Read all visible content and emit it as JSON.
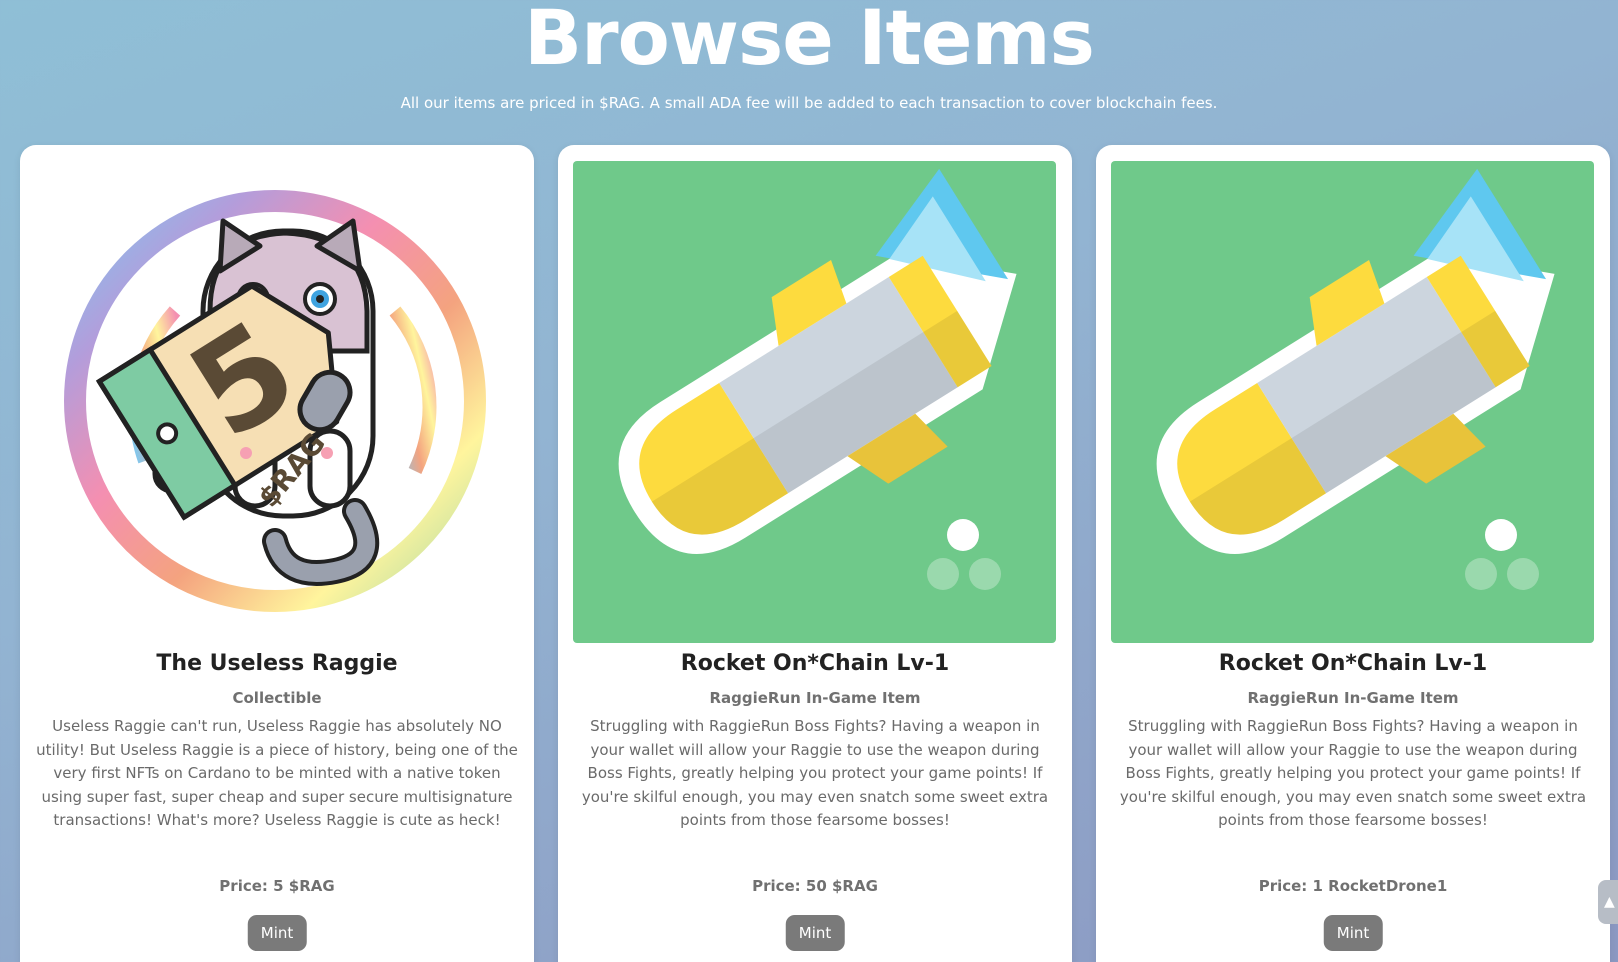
{
  "header": {
    "title": "Browse Items",
    "subtitle": "All our items are priced in $RAG. A small ADA fee will be added to each transaction to cover blockchain fees."
  },
  "items": [
    {
      "title": "The Useless Raggie",
      "category": "Collectible",
      "description": "Useless Raggie can't run, Useless Raggie has absolutely NO utility! But Useless Raggie is a piece of history, being one of the very first NFTs on Cardano to be minted with a native token using super fast, super cheap and super secure multisignature transactions! What's more? Useless Raggie is cute as heck!",
      "price": "Price: 5 $RAG",
      "button": "Mint",
      "image_icon": "raggie-cat-price-tag",
      "tag_number": "5",
      "tag_text": "$RAG"
    },
    {
      "title": "Rocket On*Chain Lv-1",
      "category": "RaggieRun In-Game Item",
      "description": "Struggling with RaggieRun Boss Fights? Having a weapon in your wallet will allow your Raggie to use the weapon during Boss Fights, greatly helping you protect your game points! If you're skilful enough, you may even snatch some sweet extra points from those fearsome bosses!",
      "price": "Price: 50 $RAG",
      "button": "Mint",
      "image_icon": "rocket"
    },
    {
      "title": "Rocket On*Chain Lv-1",
      "category": "RaggieRun In-Game Item",
      "description": "Struggling with RaggieRun Boss Fights? Having a weapon in your wallet will allow your Raggie to use the weapon during Boss Fights, greatly helping you protect your game points! If you're skilful enough, you may even snatch some sweet extra points from those fearsome bosses!",
      "price": "Price: 1 RocketDrone1",
      "button": "Mint",
      "image_icon": "rocket"
    }
  ],
  "colors": {
    "rocket_bg": "#6fc98a",
    "button_bg": "#7a7a7a"
  }
}
